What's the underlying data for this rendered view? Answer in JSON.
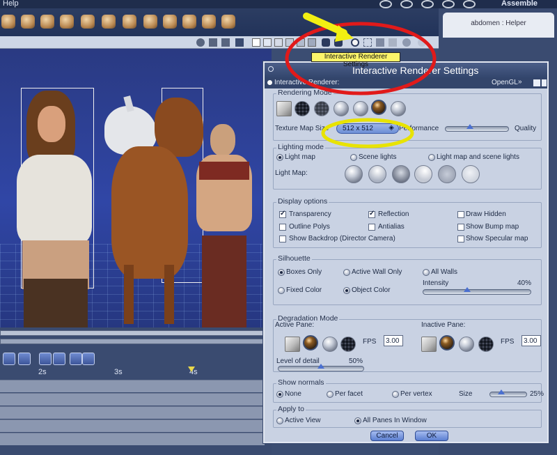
{
  "menubar": {
    "help": "Help",
    "assemble": "Assemble"
  },
  "helper": {
    "label": "abdomen : Helper"
  },
  "tooltip": {
    "text": "Interactive Renderer Settings"
  },
  "timeline": {
    "ticks": [
      "2s",
      "3s",
      "4s"
    ]
  },
  "dialog": {
    "title": "Interactive Renderer Settings",
    "renderer_label": "Interactive Renderer:",
    "renderer_value": "OpenGL",
    "rendering_mode": {
      "title": "Rendering Mode"
    },
    "texture": {
      "label": "Texture Map Size",
      "value": "512 x  512",
      "performance": "Performance",
      "quality": "Quality"
    },
    "lighting": {
      "title": "Lighting mode",
      "options": [
        "Light map",
        "Scene lights",
        "Light map and scene lights"
      ],
      "lightmap_label": "Light Map:"
    },
    "display": {
      "title": "Display options",
      "options": [
        "Transparency",
        "Reflection",
        "Draw Hidden",
        "Outline Polys",
        "Antialias",
        "Show Bump map",
        "Show Backdrop (Director Camera)",
        "Show Specular map"
      ]
    },
    "silhouette": {
      "title": "Silhouette",
      "options": [
        "Boxes Only",
        "Active Wall Only",
        "All Walls",
        "Fixed Color",
        "Object Color"
      ],
      "intensity_label": "Intensity",
      "intensity_value": "40%",
      "intensity_fraction": 0.4
    },
    "degradation": {
      "title": "Degradation Mode",
      "active_label": "Active Pane:",
      "inactive_label": "Inactive Pane:",
      "fps_label": "FPS",
      "fps_active": "3.00",
      "fps_inactive": "3.00",
      "lod_label": "Level of detail",
      "lod_value": "50%",
      "lod_fraction": 0.5
    },
    "normals": {
      "title": "Show normals",
      "options": [
        "None",
        "Per facet",
        "Per vertex"
      ],
      "size_label": "Size",
      "size_value": "25%",
      "size_fraction": 0.25
    },
    "apply": {
      "title": "Apply to",
      "options": [
        "Active View",
        "All Panes In Window"
      ]
    },
    "buttons": {
      "cancel": "Cancel",
      "ok": "OK"
    }
  }
}
